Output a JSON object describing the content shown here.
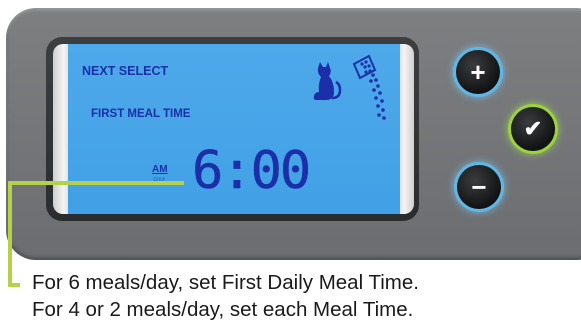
{
  "lcd": {
    "line1": "NEXT SELECT",
    "line2": "FIRST MEAL TIME",
    "am": "AM",
    "pm": "PM",
    "time": "6:00"
  },
  "buttons": {
    "plus": "+",
    "minus": "−",
    "confirm": "✔"
  },
  "colors": {
    "lcd_background": "#41a0e6",
    "lcd_text": "#1a2fa8",
    "panel": "#757779",
    "plus_minus_glow": "#5fb7e8",
    "confirm_glow": "#9bd33a",
    "callout_line": "#b7d04a"
  },
  "icons": {
    "cat": "cat-icon",
    "food": "food-bowl-icon",
    "plus": "plus-icon",
    "minus": "minus-icon",
    "confirm": "checkmark-icon"
  },
  "instructions": {
    "line1": "For 6 meals/day, set First Daily Meal Time.",
    "line2": "For 4 or 2 meals/day, set each Meal Time."
  }
}
